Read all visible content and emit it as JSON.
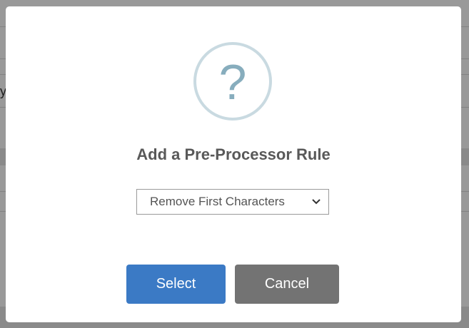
{
  "background": {
    "text_fragment": "y"
  },
  "dialog": {
    "icon": "question-mark-icon",
    "icon_glyph": "?",
    "title": "Add a Pre-Processor Rule",
    "select": {
      "value": "Remove First Characters"
    },
    "buttons": {
      "confirm_label": "Select",
      "cancel_label": "Cancel"
    }
  },
  "colors": {
    "confirm_button": "#3b7ac5",
    "cancel_button": "#737373",
    "icon_ring": "#c9dae1",
    "icon_glyph": "#87adbd",
    "title_text": "#595959"
  }
}
